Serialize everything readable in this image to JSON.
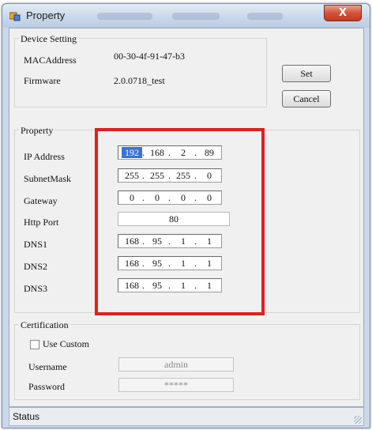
{
  "window": {
    "title": "Property",
    "close_label": "X"
  },
  "device_setting": {
    "group_label": "Device Setting",
    "mac_label": "MACAddress",
    "mac_value": "00-30-4f-91-47-b3",
    "firmware_label": "Firmware",
    "firmware_value": "2.0.0718_test"
  },
  "buttons": {
    "set_label": "Set",
    "cancel_label": "Cancel"
  },
  "property": {
    "group_label": "Property",
    "ip": {
      "label": "IP Address",
      "octets": [
        "192",
        "168",
        "2",
        "89"
      ]
    },
    "subnet": {
      "label": "SubnetMask",
      "octets": [
        "255",
        "255",
        "255",
        "0"
      ]
    },
    "gateway": {
      "label": "Gateway",
      "octets": [
        "0",
        "0",
        "0",
        "0"
      ]
    },
    "http_port": {
      "label": "Http Port",
      "value": "80"
    },
    "dns1": {
      "label": "DNS1",
      "octets": [
        "168",
        "95",
        "1",
        "1"
      ]
    },
    "dns2": {
      "label": "DNS2",
      "octets": [
        "168",
        "95",
        "1",
        "1"
      ]
    },
    "dns3": {
      "label": "DNS3",
      "octets": [
        "168",
        "95",
        "1",
        "1"
      ]
    }
  },
  "certification": {
    "group_label": "Certification",
    "use_custom_label": "Use Custom",
    "use_custom_checked": false,
    "username_label": "Username",
    "username_value": "admin",
    "password_label": "Password",
    "password_value": "*****"
  },
  "status": {
    "text": "Status"
  },
  "colors": {
    "highlight": "#e0201c",
    "selection": "#3a73d1",
    "close": "#c23a22"
  }
}
